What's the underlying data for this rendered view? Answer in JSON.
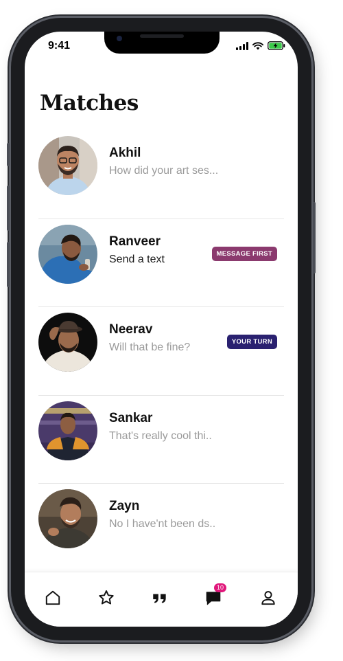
{
  "status_bar": {
    "time": "9:41"
  },
  "page": {
    "title": "Matches"
  },
  "matches": [
    {
      "name": "Akhil",
      "preview": "How did your art ses...",
      "badge": null
    },
    {
      "name": "Ranveer",
      "preview": "Send a text",
      "badge": "MESSAGE FIRST",
      "badge_color": "#8b3a6e"
    },
    {
      "name": "Neerav",
      "preview": "Will that be fine?",
      "badge": "YOUR TURN",
      "badge_color": "#2a2170"
    },
    {
      "name": "Sankar",
      "preview": "That's really cool thi..",
      "badge": null
    },
    {
      "name": "Zayn",
      "preview": "No I have'nt been ds..",
      "badge": null
    }
  ],
  "tab_bar": {
    "tabs": [
      {
        "icon": "home-icon"
      },
      {
        "icon": "star-icon"
      },
      {
        "icon": "quote-icon"
      },
      {
        "icon": "chat-icon",
        "badge": "10"
      },
      {
        "icon": "profile-icon"
      }
    ]
  },
  "colors": {
    "accent_badge": "#e0177b",
    "message_first": "#8b3a6e",
    "your_turn": "#2a2170"
  }
}
